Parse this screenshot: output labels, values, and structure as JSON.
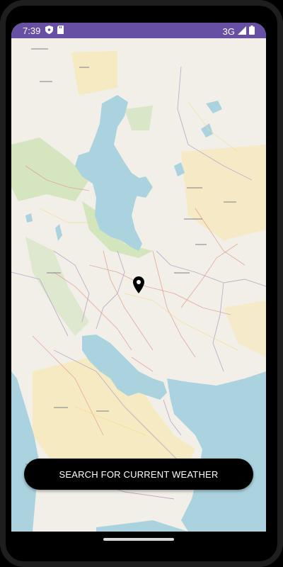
{
  "status_bar": {
    "time": "7:39",
    "network": "3G",
    "left_icons": [
      "shield-icon",
      "sd-card-icon"
    ],
    "right_icons": [
      "signal-icon",
      "battery-icon"
    ],
    "background": "#6750a4"
  },
  "map": {
    "marker_icon": "location-pin-icon",
    "land_color": "#f2efe9",
    "water_color": "#aad3df"
  },
  "action_button": {
    "label": "SEARCH FOR CURRENT WEATHER",
    "background": "#000000",
    "text_color": "#ffffff"
  },
  "navigation": {
    "handle_icon": "gesture-handle"
  }
}
